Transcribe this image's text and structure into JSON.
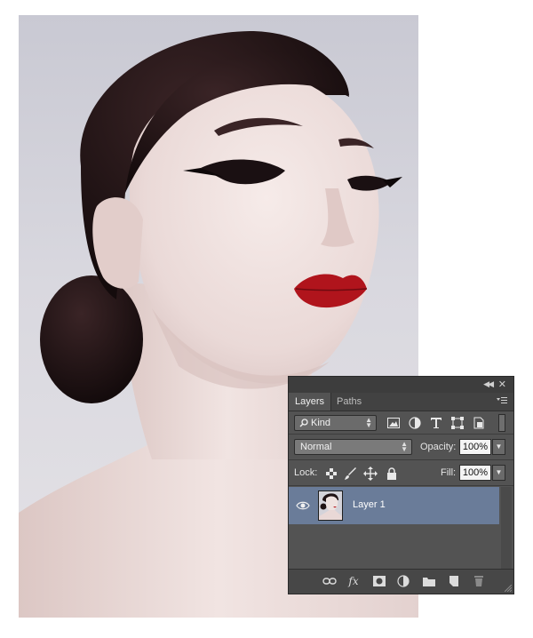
{
  "panel": {
    "tabs": [
      {
        "label": "Layers",
        "active": true
      },
      {
        "label": "Paths",
        "active": false
      }
    ],
    "filter": {
      "kind_label": "Kind"
    },
    "blend_mode": "Normal",
    "opacity_label": "Opacity:",
    "opacity_value": "100%",
    "lock_label": "Lock:",
    "fill_label": "Fill:",
    "fill_value": "100%",
    "layers": [
      {
        "name": "Layer 1",
        "visible": true,
        "selected": true
      }
    ],
    "bottom_icons": [
      "link-icon",
      "fx-icon",
      "mask-icon",
      "adjustment-icon",
      "folder-icon",
      "new-layer-icon",
      "trash-icon"
    ],
    "fx_label": "fx"
  },
  "colors": {
    "panel_bg": "#535353",
    "selected_layer": "#6a7c99",
    "lipstick": "#b0141c"
  }
}
